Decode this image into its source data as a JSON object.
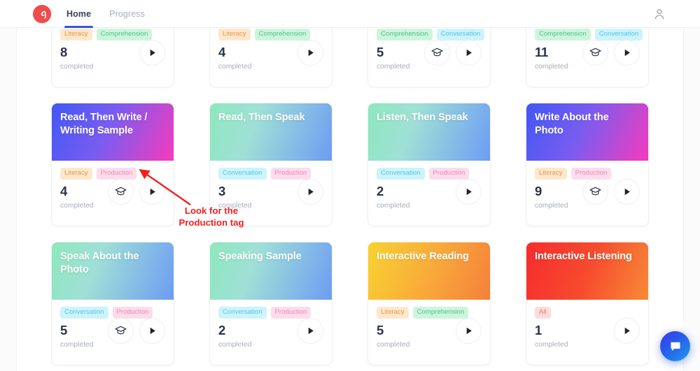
{
  "header": {
    "logo_icon": "app-logo-a-icon",
    "tabs": [
      {
        "label": "Home",
        "active": true
      },
      {
        "label": "Progress",
        "active": false
      }
    ],
    "profile_icon": "user-account-icon"
  },
  "annotation": {
    "text_line1": "Look for the",
    "text_line2": "Production tag",
    "color": "#f51d1d",
    "arrow_icon": "red-arrow-icon"
  },
  "chat_fab": {
    "icon": "chat-bubble-icon",
    "color": "#2563eb"
  },
  "card_meta": {
    "completed_label": "completed",
    "practice_icon": "graduation-cap-icon",
    "play_icon": "play-triangle-icon"
  },
  "tag_colors": {
    "Literacy": {
      "bg": "#fde8cd",
      "fg": "#f09340"
    },
    "Production": {
      "bg": "#fbddec",
      "fg": "#f483b4"
    },
    "Conversation": {
      "bg": "#cdf3fb",
      "fg": "#4fc7e8"
    },
    "Comprehension": {
      "bg": "#cdf5dd",
      "fg": "#4dc585"
    },
    "All": {
      "bg": "#fcdcdc",
      "fg": "#f07272"
    }
  },
  "cards": [
    {
      "title": "",
      "gradient": "g-yelorange",
      "tags": [
        "Literacy",
        "Comprehension"
      ],
      "count": "8",
      "has_practice": false,
      "partial": true
    },
    {
      "title": "",
      "gradient": "g-yelorange",
      "tags": [
        "Literacy",
        "Comprehension"
      ],
      "count": "4",
      "has_practice": false,
      "partial": true
    },
    {
      "title": "",
      "gradient": "g-greenblue",
      "tags": [
        "Comprehension",
        "Conversation"
      ],
      "count": "5",
      "has_practice": true,
      "partial": true
    },
    {
      "title": "",
      "gradient": "g-greenblue",
      "tags": [
        "Comprehension",
        "Conversation"
      ],
      "count": "11",
      "has_practice": true,
      "partial": true
    },
    {
      "title": "Read, Then Write / Writing Sample",
      "gradient": "g-bluepink",
      "tags": [
        "Literacy",
        "Production"
      ],
      "count": "4",
      "has_practice": true,
      "partial": false
    },
    {
      "title": "Read, Then Speak",
      "gradient": "g-greenblue",
      "tags": [
        "Conversation",
        "Production"
      ],
      "count": "3",
      "has_practice": false,
      "partial": false
    },
    {
      "title": "Listen, Then Speak",
      "gradient": "g-greenblue",
      "tags": [
        "Conversation",
        "Production"
      ],
      "count": "2",
      "has_practice": false,
      "partial": false
    },
    {
      "title": "Write About the Photo",
      "gradient": "g-bluepink",
      "tags": [
        "Literacy",
        "Production"
      ],
      "count": "9",
      "has_practice": true,
      "partial": false
    },
    {
      "title": "Speak About the Photo",
      "gradient": "g-greenblue",
      "tags": [
        "Conversation",
        "Production"
      ],
      "count": "5",
      "has_practice": true,
      "partial": false
    },
    {
      "title": "Speaking Sample",
      "gradient": "g-greenblue",
      "tags": [
        "Conversation",
        "Production"
      ],
      "count": "2",
      "has_practice": false,
      "partial": false
    },
    {
      "title": "Interactive Reading",
      "gradient": "g-yelorange",
      "tags": [
        "Literacy",
        "Comprehension"
      ],
      "count": "5",
      "has_practice": false,
      "partial": false
    },
    {
      "title": "Interactive Listening",
      "gradient": "g-redorange",
      "tags": [
        "All"
      ],
      "count": "1",
      "has_practice": false,
      "partial": false
    }
  ]
}
